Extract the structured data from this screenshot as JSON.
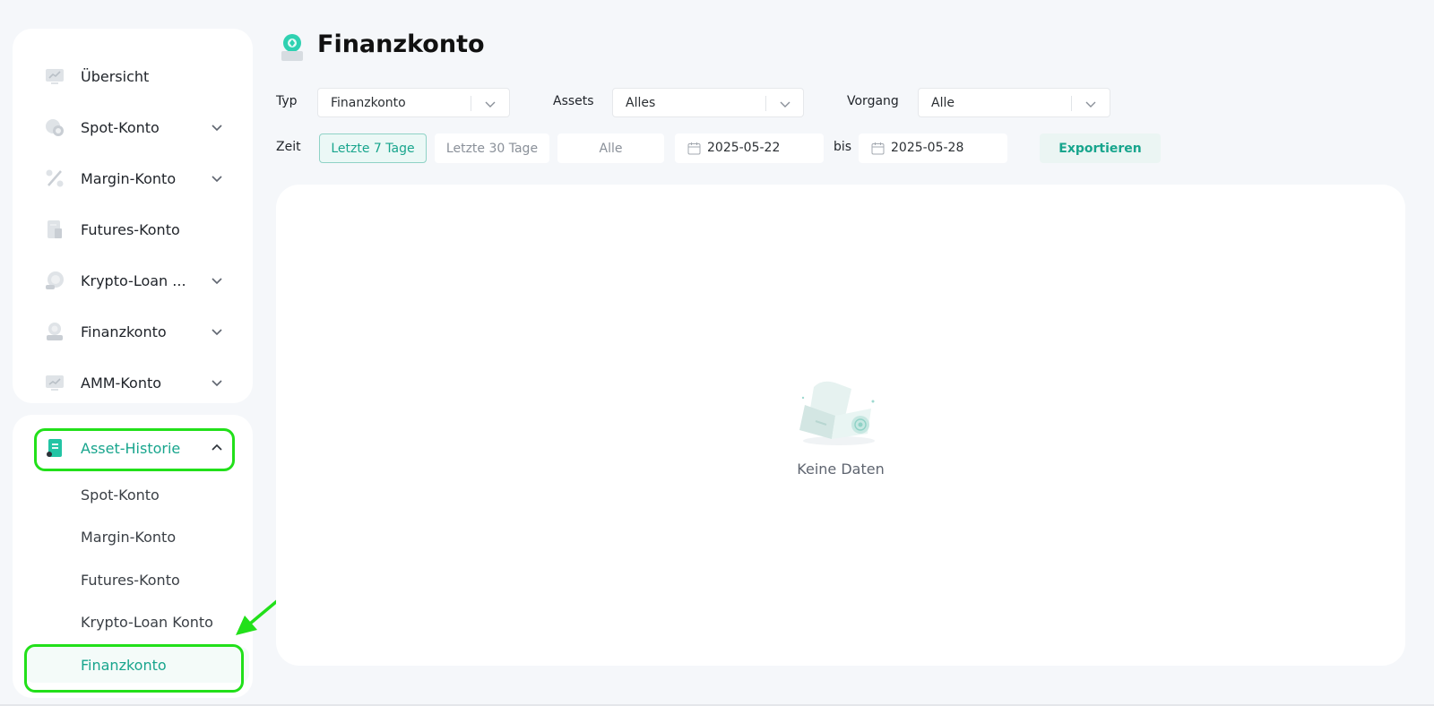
{
  "sidebar": {
    "main_items": [
      {
        "label": "Übersicht",
        "icon": "chart-monitor-icon",
        "has_chevron": false
      },
      {
        "label": "Spot-Konto",
        "icon": "coins-icon",
        "has_chevron": true
      },
      {
        "label": "Margin-Konto",
        "icon": "percent-icon",
        "has_chevron": true
      },
      {
        "label": "Futures-Konto",
        "icon": "document-icon",
        "has_chevron": false
      },
      {
        "label": "Krypto-Loan ...",
        "icon": "loan-coin-icon",
        "has_chevron": true
      },
      {
        "label": "Finanzkonto",
        "icon": "finance-person-icon",
        "has_chevron": true
      },
      {
        "label": "AMM-Konto",
        "icon": "amm-monitor-icon",
        "has_chevron": true
      }
    ],
    "history": {
      "label": "Asset-Historie",
      "icon": "history-book-icon",
      "sub_items": [
        "Spot-Konto",
        "Margin-Konto",
        "Futures-Konto",
        "Krypto-Loan Konto",
        "Finanzkonto"
      ],
      "active_sub": "Finanzkonto"
    }
  },
  "header": {
    "title": "Finanzkonto",
    "icon": "finance-account-icon"
  },
  "filters": {
    "type_label": "Typ",
    "type_value": "Finanzkonto",
    "assets_label": "Assets",
    "assets_value": "Alles",
    "process_label": "Vorgang",
    "process_value": "Alle",
    "time_label": "Zeit",
    "time_options": [
      "Letzte 7 Tage",
      "Letzte 30 Tage",
      "Alle"
    ],
    "time_active": "Letzte 7 Tage",
    "date_from": "2025-05-22",
    "date_sep": "bis",
    "date_to": "2025-05-28",
    "export_label": "Exportieren"
  },
  "content": {
    "empty_text": "Keine Daten",
    "empty_icon": "empty-document-icon"
  },
  "colors": {
    "accent": "#18a58d",
    "highlight": "#22e01a",
    "background": "#f5f7fa"
  }
}
